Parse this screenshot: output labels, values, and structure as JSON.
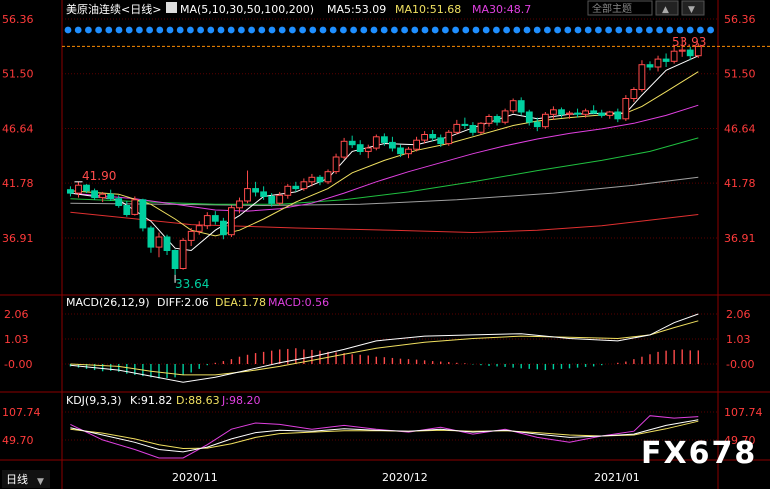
{
  "header": {
    "symbol": "美原油连续<日线>",
    "ma_params": "MA(5,10,30,50,100,200)",
    "ma5": "MA5:53.09",
    "ma10": "MA10:51.68",
    "ma30": "MA30:48.7",
    "menu_label": "全部主题"
  },
  "colors": {
    "up": "#ff4b4b",
    "down": "#00d0a0",
    "ma5": "#ffffff",
    "ma10": "#f0e060",
    "ma30": "#e040e0",
    "ma50": "#20c040",
    "ma100": "#a0a0a0",
    "ma200": "#e03030",
    "price_axis": "#ff3b3b",
    "grid": "#5a0000",
    "dots": "#1f8fff"
  },
  "price_axis": [
    "56.36",
    "51.50",
    "46.64",
    "41.78",
    "36.91"
  ],
  "annotations": {
    "high_label": "41.90",
    "low_label": "33.64",
    "last_label": "53.93"
  },
  "macd_panel": {
    "title": "MACD(26,12,9)",
    "diff": "DIFF:2.06",
    "dea": "DEA:1.78",
    "macd": "MACD:0.56",
    "axis": [
      "2.06",
      "1.03",
      "-0.00"
    ]
  },
  "kdj_panel": {
    "title": "KDJ(9,3,3)",
    "k": "K:91.82",
    "d": "D:88.63",
    "j": "J:98.20",
    "axis": [
      "107.74",
      "49.70"
    ]
  },
  "x_axis": [
    "2020/11",
    "2020/12",
    "2021/01"
  ],
  "bottom_tab": "日线",
  "watermark": "FX678",
  "chart_data": {
    "type": "candlestick",
    "ylim": [
      33.0,
      57.5
    ],
    "candles": [
      [
        41.2,
        41.5,
        40.6,
        40.9
      ],
      [
        40.9,
        41.9,
        40.5,
        41.6
      ],
      [
        41.6,
        41.7,
        40.9,
        41.1
      ],
      [
        41.1,
        41.3,
        40.3,
        40.5
      ],
      [
        40.5,
        41.0,
        40.1,
        40.8
      ],
      [
        40.8,
        41.2,
        40.2,
        40.4
      ],
      [
        40.4,
        40.7,
        39.6,
        39.8
      ],
      [
        39.8,
        40.2,
        38.8,
        39.0
      ],
      [
        39.0,
        40.6,
        38.9,
        40.3
      ],
      [
        40.3,
        40.4,
        37.5,
        37.8
      ],
      [
        37.8,
        38.0,
        35.6,
        36.1
      ],
      [
        36.1,
        37.4,
        35.2,
        37.0
      ],
      [
        37.0,
        37.2,
        35.4,
        35.8
      ],
      [
        35.8,
        35.9,
        33.64,
        34.2
      ],
      [
        34.2,
        36.9,
        34.1,
        36.7
      ],
      [
        36.7,
        37.8,
        36.2,
        37.5
      ],
      [
        37.5,
        38.4,
        37.2,
        38.0
      ],
      [
        38.0,
        39.2,
        37.7,
        38.9
      ],
      [
        38.9,
        39.3,
        38.1,
        38.4
      ],
      [
        38.4,
        38.7,
        36.8,
        37.2
      ],
      [
        37.2,
        39.8,
        37.0,
        39.6
      ],
      [
        39.6,
        40.5,
        39.1,
        40.2
      ],
      [
        40.2,
        42.9,
        40.0,
        41.3
      ],
      [
        41.3,
        41.9,
        40.6,
        41.0
      ],
      [
        41.0,
        41.5,
        40.3,
        40.6
      ],
      [
        40.6,
        40.9,
        39.7,
        40.0
      ],
      [
        40.0,
        41.0,
        39.8,
        40.7
      ],
      [
        40.7,
        41.7,
        40.4,
        41.5
      ],
      [
        41.5,
        41.9,
        41.0,
        41.3
      ],
      [
        41.3,
        42.2,
        41.1,
        41.9
      ],
      [
        41.9,
        42.6,
        41.5,
        42.3
      ],
      [
        42.3,
        42.5,
        41.6,
        41.9
      ],
      [
        41.9,
        43.0,
        41.7,
        42.8
      ],
      [
        42.8,
        44.4,
        42.6,
        44.1
      ],
      [
        44.1,
        45.8,
        43.9,
        45.5
      ],
      [
        45.5,
        46.0,
        44.9,
        45.2
      ],
      [
        45.2,
        45.6,
        44.3,
        44.6
      ],
      [
        44.6,
        45.2,
        44.0,
        44.9
      ],
      [
        44.9,
        46.1,
        44.7,
        45.9
      ],
      [
        45.9,
        46.2,
        45.1,
        45.4
      ],
      [
        45.4,
        45.9,
        44.6,
        44.9
      ],
      [
        44.9,
        45.2,
        44.1,
        44.4
      ],
      [
        44.4,
        45.0,
        44.0,
        44.8
      ],
      [
        44.8,
        45.9,
        44.6,
        45.6
      ],
      [
        45.6,
        46.4,
        45.3,
        46.1
      ],
      [
        46.1,
        46.5,
        45.5,
        45.8
      ],
      [
        45.8,
        46.1,
        45.0,
        45.3
      ],
      [
        45.3,
        46.5,
        45.1,
        46.3
      ],
      [
        46.3,
        47.4,
        46.1,
        47.0
      ],
      [
        47.0,
        47.6,
        46.6,
        46.9
      ],
      [
        46.9,
        47.2,
        46.0,
        46.3
      ],
      [
        46.3,
        47.2,
        46.1,
        47.1
      ],
      [
        47.1,
        47.9,
        46.8,
        47.7
      ],
      [
        47.7,
        47.9,
        46.9,
        47.2
      ],
      [
        47.2,
        48.4,
        47.0,
        48.2
      ],
      [
        48.2,
        49.3,
        48.0,
        49.1
      ],
      [
        49.1,
        49.4,
        47.8,
        48.1
      ],
      [
        48.1,
        48.3,
        46.9,
        47.2
      ],
      [
        47.2,
        47.6,
        46.4,
        46.8
      ],
      [
        46.8,
        48.1,
        46.6,
        47.9
      ],
      [
        47.9,
        48.6,
        47.4,
        48.3
      ],
      [
        48.3,
        48.5,
        47.6,
        47.9
      ],
      [
        47.9,
        48.2,
        47.5,
        48.0
      ],
      [
        48.0,
        48.4,
        47.6,
        47.9
      ],
      [
        47.9,
        48.4,
        47.6,
        48.2
      ],
      [
        48.2,
        48.7,
        47.9,
        48.0
      ],
      [
        48.0,
        48.3,
        47.6,
        47.8
      ],
      [
        47.8,
        48.2,
        47.5,
        48.1
      ],
      [
        48.1,
        48.4,
        47.2,
        47.5
      ],
      [
        47.5,
        49.6,
        47.3,
        49.3
      ],
      [
        49.3,
        50.3,
        49.0,
        50.1
      ],
      [
        50.1,
        52.7,
        49.9,
        52.3
      ],
      [
        52.3,
        52.6,
        51.8,
        52.1
      ],
      [
        52.1,
        53.1,
        51.7,
        52.8
      ],
      [
        52.8,
        53.3,
        52.1,
        52.6
      ],
      [
        52.6,
        53.9,
        52.4,
        53.5
      ],
      [
        53.5,
        54.7,
        53.0,
        53.6
      ],
      [
        53.6,
        53.9,
        52.7,
        53.1
      ],
      [
        53.1,
        54.2,
        52.9,
        53.93
      ]
    ],
    "ma_lines": {
      "ma5": [
        [
          0,
          40.9
        ],
        [
          6,
          40.3
        ],
        [
          10,
          38.4
        ],
        [
          13,
          36.0
        ],
        [
          15,
          35.8
        ],
        [
          18,
          37.6
        ],
        [
          21,
          38.9
        ],
        [
          24,
          40.6
        ],
        [
          28,
          41.0
        ],
        [
          32,
          42.2
        ],
        [
          35,
          44.6
        ],
        [
          39,
          45.3
        ],
        [
          43,
          45.2
        ],
        [
          47,
          45.9
        ],
        [
          50,
          46.7
        ],
        [
          55,
          47.9
        ],
        [
          58,
          47.5
        ],
        [
          62,
          47.9
        ],
        [
          67,
          48.0
        ],
        [
          69,
          48.0
        ],
        [
          71,
          49.6
        ],
        [
          74,
          51.8
        ],
        [
          78,
          53.09
        ]
      ],
      "ma10": [
        [
          0,
          41.1
        ],
        [
          6,
          40.8
        ],
        [
          10,
          39.9
        ],
        [
          13,
          38.6
        ],
        [
          15,
          37.6
        ],
        [
          18,
          37.1
        ],
        [
          21,
          37.6
        ],
        [
          24,
          38.6
        ],
        [
          28,
          40.1
        ],
        [
          32,
          41.3
        ],
        [
          35,
          42.7
        ],
        [
          39,
          43.8
        ],
        [
          43,
          44.7
        ],
        [
          47,
          45.3
        ],
        [
          50,
          45.9
        ],
        [
          55,
          46.9
        ],
        [
          58,
          47.3
        ],
        [
          62,
          47.6
        ],
        [
          67,
          47.9
        ],
        [
          69,
          48.0
        ],
        [
          71,
          48.6
        ],
        [
          74,
          49.9
        ],
        [
          78,
          51.68
        ]
      ],
      "ma30": [
        [
          0,
          40.9
        ],
        [
          8,
          40.4
        ],
        [
          13,
          39.9
        ],
        [
          18,
          39.4
        ],
        [
          22,
          39.3
        ],
        [
          26,
          39.5
        ],
        [
          30,
          40.0
        ],
        [
          34,
          40.9
        ],
        [
          38,
          41.9
        ],
        [
          42,
          42.8
        ],
        [
          46,
          43.6
        ],
        [
          50,
          44.4
        ],
        [
          54,
          45.1
        ],
        [
          58,
          45.7
        ],
        [
          62,
          46.2
        ],
        [
          66,
          46.6
        ],
        [
          70,
          47.1
        ],
        [
          74,
          47.8
        ],
        [
          78,
          48.7
        ]
      ],
      "ma50": [
        [
          0,
          40.4
        ],
        [
          10,
          40.1
        ],
        [
          18,
          39.9
        ],
        [
          26,
          39.9
        ],
        [
          34,
          40.3
        ],
        [
          42,
          41.0
        ],
        [
          50,
          41.9
        ],
        [
          58,
          42.9
        ],
        [
          66,
          43.8
        ],
        [
          72,
          44.6
        ],
        [
          78,
          45.8
        ]
      ],
      "ma100": [
        [
          0,
          40.0
        ],
        [
          12,
          39.9
        ],
        [
          24,
          39.8
        ],
        [
          36,
          39.9
        ],
        [
          48,
          40.3
        ],
        [
          60,
          40.9
        ],
        [
          70,
          41.6
        ],
        [
          78,
          42.3
        ]
      ],
      "ma200": [
        [
          0,
          39.2
        ],
        [
          15,
          38.1
        ],
        [
          28,
          37.8
        ],
        [
          40,
          37.6
        ],
        [
          50,
          37.4
        ],
        [
          58,
          37.6
        ],
        [
          66,
          38.0
        ],
        [
          72,
          38.5
        ],
        [
          78,
          39.0
        ]
      ]
    },
    "macd": {
      "ylim": [
        -0.95,
        2.3
      ],
      "diff": [
        [
          0,
          -0.05
        ],
        [
          6,
          -0.25
        ],
        [
          10,
          -0.5
        ],
        [
          14,
          -0.75
        ],
        [
          18,
          -0.55
        ],
        [
          22,
          -0.25
        ],
        [
          26,
          0.05
        ],
        [
          30,
          0.3
        ],
        [
          34,
          0.6
        ],
        [
          38,
          0.95
        ],
        [
          44,
          1.15
        ],
        [
          50,
          1.2
        ],
        [
          56,
          1.25
        ],
        [
          62,
          1.05
        ],
        [
          68,
          0.95
        ],
        [
          72,
          1.2
        ],
        [
          75,
          1.7
        ],
        [
          78,
          2.06
        ]
      ],
      "dea": [
        [
          0,
          0.0
        ],
        [
          6,
          -0.1
        ],
        [
          10,
          -0.3
        ],
        [
          14,
          -0.45
        ],
        [
          18,
          -0.45
        ],
        [
          22,
          -0.3
        ],
        [
          26,
          -0.1
        ],
        [
          30,
          0.15
        ],
        [
          34,
          0.4
        ],
        [
          38,
          0.65
        ],
        [
          44,
          0.9
        ],
        [
          50,
          1.05
        ],
        [
          56,
          1.15
        ],
        [
          62,
          1.1
        ],
        [
          68,
          1.05
        ],
        [
          72,
          1.2
        ],
        [
          75,
          1.5
        ],
        [
          78,
          1.78
        ]
      ],
      "hist": [
        -0.1,
        -0.15,
        -0.2,
        -0.25,
        -0.3,
        -0.28,
        -0.32,
        -0.4,
        -0.45,
        -0.5,
        -0.55,
        -0.6,
        -0.58,
        -0.55,
        -0.45,
        -0.35,
        -0.2,
        -0.05,
        0.05,
        0.12,
        0.2,
        0.3,
        0.38,
        0.45,
        0.5,
        0.55,
        0.6,
        0.62,
        0.65,
        0.6,
        0.58,
        0.55,
        0.5,
        0.48,
        0.45,
        0.4,
        0.38,
        0.35,
        0.3,
        0.28,
        0.25,
        0.22,
        0.2,
        0.18,
        0.15,
        0.12,
        0.1,
        0.08,
        0.05,
        0.03,
        -0.02,
        -0.05,
        -0.08,
        -0.1,
        -0.12,
        -0.15,
        -0.18,
        -0.2,
        -0.22,
        -0.25,
        -0.22,
        -0.2,
        -0.18,
        -0.15,
        -0.12,
        -0.1,
        -0.05,
        0.0,
        0.05,
        0.1,
        0.2,
        0.3,
        0.4,
        0.5,
        0.55,
        0.58,
        0.6,
        0.56,
        0.56
      ]
    },
    "kdj": {
      "ylim": [
        0,
        120
      ],
      "k": [
        [
          0,
          75
        ],
        [
          4,
          60
        ],
        [
          8,
          45
        ],
        [
          11,
          30
        ],
        [
          14,
          25
        ],
        [
          17,
          35
        ],
        [
          20,
          52
        ],
        [
          23,
          65
        ],
        [
          26,
          70
        ],
        [
          30,
          68
        ],
        [
          34,
          73
        ],
        [
          38,
          70
        ],
        [
          42,
          68
        ],
        [
          46,
          72
        ],
        [
          50,
          66
        ],
        [
          54,
          70
        ],
        [
          58,
          62
        ],
        [
          62,
          55
        ],
        [
          66,
          58
        ],
        [
          70,
          62
        ],
        [
          74,
          80
        ],
        [
          78,
          91.82
        ]
      ],
      "d": [
        [
          0,
          72
        ],
        [
          4,
          64
        ],
        [
          8,
          52
        ],
        [
          11,
          40
        ],
        [
          14,
          32
        ],
        [
          17,
          33
        ],
        [
          20,
          42
        ],
        [
          23,
          55
        ],
        [
          26,
          63
        ],
        [
          30,
          66
        ],
        [
          34,
          69
        ],
        [
          38,
          69
        ],
        [
          42,
          68
        ],
        [
          46,
          70
        ],
        [
          50,
          68
        ],
        [
          54,
          69
        ],
        [
          58,
          65
        ],
        [
          62,
          60
        ],
        [
          66,
          58
        ],
        [
          70,
          60
        ],
        [
          74,
          73
        ],
        [
          78,
          88.63
        ]
      ],
      "j": [
        [
          0,
          82
        ],
        [
          4,
          50
        ],
        [
          8,
          30
        ],
        [
          11,
          12
        ],
        [
          14,
          10
        ],
        [
          17,
          40
        ],
        [
          20,
          72
        ],
        [
          23,
          85
        ],
        [
          26,
          82
        ],
        [
          30,
          72
        ],
        [
          34,
          80
        ],
        [
          38,
          72
        ],
        [
          42,
          66
        ],
        [
          46,
          76
        ],
        [
          50,
          62
        ],
        [
          54,
          72
        ],
        [
          58,
          55
        ],
        [
          62,
          45
        ],
        [
          66,
          58
        ],
        [
          70,
          68
        ],
        [
          72,
          100
        ],
        [
          75,
          95
        ],
        [
          78,
          98.2
        ]
      ]
    }
  }
}
